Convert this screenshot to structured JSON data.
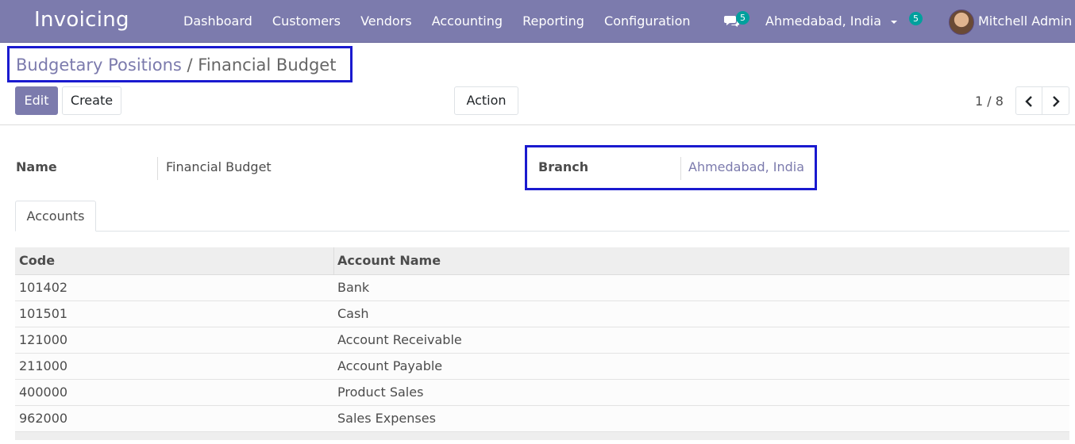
{
  "navbar": {
    "brand": "Invoicing",
    "menu": [
      "Dashboard",
      "Customers",
      "Vendors",
      "Accounting",
      "Reporting",
      "Configuration"
    ],
    "messages_badge": "5",
    "company": "Ahmedabad, India",
    "activity_badge": "5",
    "user": "Mitchell Admin"
  },
  "breadcrumb": {
    "parent": "Budgetary Positions",
    "separator": "/",
    "current": "Financial Budget"
  },
  "buttons": {
    "edit": "Edit",
    "create": "Create",
    "action": "Action"
  },
  "pager": {
    "value": "1 / 8"
  },
  "form": {
    "name_label": "Name",
    "name_value": "Financial Budget",
    "branch_label": "Branch",
    "branch_value": "Ahmedabad, India"
  },
  "tabs": [
    "Accounts"
  ],
  "table": {
    "headers": [
      "Code",
      "Account Name"
    ],
    "rows": [
      [
        "101402",
        "Bank"
      ],
      [
        "101501",
        "Cash"
      ],
      [
        "121000",
        "Account Receivable"
      ],
      [
        "211000",
        "Account Payable"
      ],
      [
        "400000",
        "Product Sales"
      ],
      [
        "962000",
        "Sales Expenses"
      ]
    ]
  },
  "colors": {
    "brand": "#7c7bad",
    "badge": "#00a09d",
    "highlight": "#1a1acf"
  }
}
